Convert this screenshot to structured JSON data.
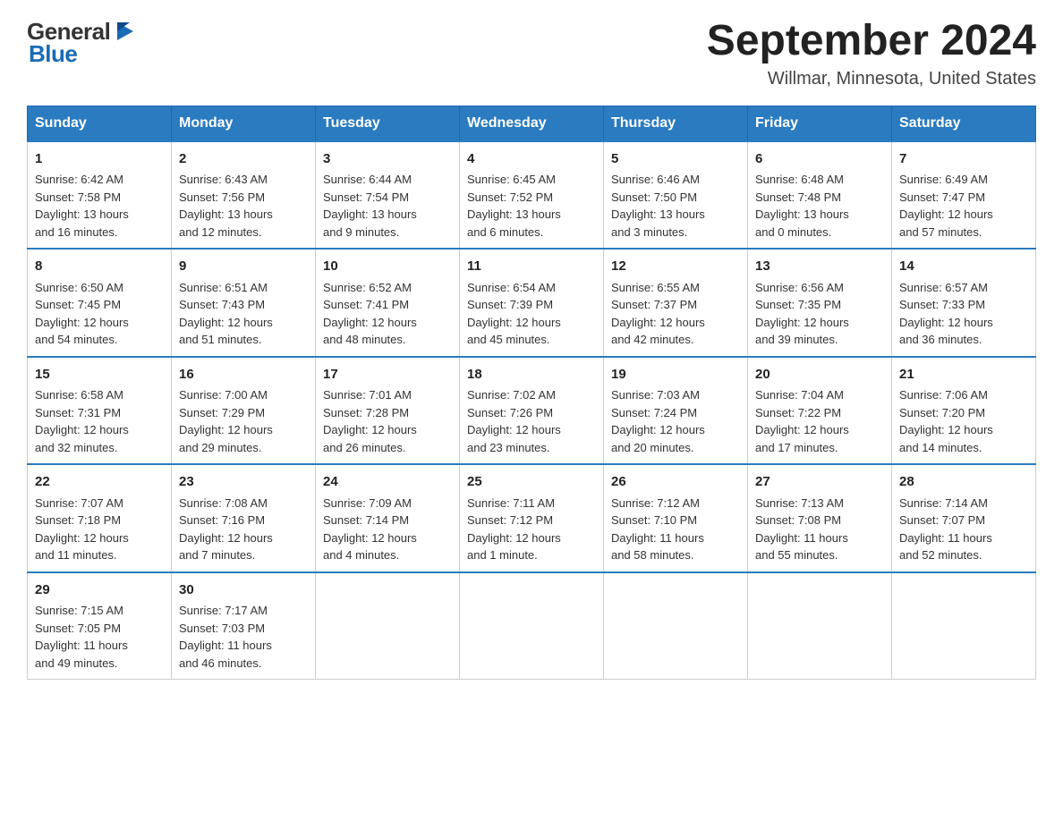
{
  "logo": {
    "general": "General",
    "blue": "Blue"
  },
  "title": {
    "month_year": "September 2024",
    "location": "Willmar, Minnesota, United States"
  },
  "headers": [
    "Sunday",
    "Monday",
    "Tuesday",
    "Wednesday",
    "Thursday",
    "Friday",
    "Saturday"
  ],
  "weeks": [
    [
      {
        "day": "1",
        "info": "Sunrise: 6:42 AM\nSunset: 7:58 PM\nDaylight: 13 hours\nand 16 minutes."
      },
      {
        "day": "2",
        "info": "Sunrise: 6:43 AM\nSunset: 7:56 PM\nDaylight: 13 hours\nand 12 minutes."
      },
      {
        "day": "3",
        "info": "Sunrise: 6:44 AM\nSunset: 7:54 PM\nDaylight: 13 hours\nand 9 minutes."
      },
      {
        "day": "4",
        "info": "Sunrise: 6:45 AM\nSunset: 7:52 PM\nDaylight: 13 hours\nand 6 minutes."
      },
      {
        "day": "5",
        "info": "Sunrise: 6:46 AM\nSunset: 7:50 PM\nDaylight: 13 hours\nand 3 minutes."
      },
      {
        "day": "6",
        "info": "Sunrise: 6:48 AM\nSunset: 7:48 PM\nDaylight: 13 hours\nand 0 minutes."
      },
      {
        "day": "7",
        "info": "Sunrise: 6:49 AM\nSunset: 7:47 PM\nDaylight: 12 hours\nand 57 minutes."
      }
    ],
    [
      {
        "day": "8",
        "info": "Sunrise: 6:50 AM\nSunset: 7:45 PM\nDaylight: 12 hours\nand 54 minutes."
      },
      {
        "day": "9",
        "info": "Sunrise: 6:51 AM\nSunset: 7:43 PM\nDaylight: 12 hours\nand 51 minutes."
      },
      {
        "day": "10",
        "info": "Sunrise: 6:52 AM\nSunset: 7:41 PM\nDaylight: 12 hours\nand 48 minutes."
      },
      {
        "day": "11",
        "info": "Sunrise: 6:54 AM\nSunset: 7:39 PM\nDaylight: 12 hours\nand 45 minutes."
      },
      {
        "day": "12",
        "info": "Sunrise: 6:55 AM\nSunset: 7:37 PM\nDaylight: 12 hours\nand 42 minutes."
      },
      {
        "day": "13",
        "info": "Sunrise: 6:56 AM\nSunset: 7:35 PM\nDaylight: 12 hours\nand 39 minutes."
      },
      {
        "day": "14",
        "info": "Sunrise: 6:57 AM\nSunset: 7:33 PM\nDaylight: 12 hours\nand 36 minutes."
      }
    ],
    [
      {
        "day": "15",
        "info": "Sunrise: 6:58 AM\nSunset: 7:31 PM\nDaylight: 12 hours\nand 32 minutes."
      },
      {
        "day": "16",
        "info": "Sunrise: 7:00 AM\nSunset: 7:29 PM\nDaylight: 12 hours\nand 29 minutes."
      },
      {
        "day": "17",
        "info": "Sunrise: 7:01 AM\nSunset: 7:28 PM\nDaylight: 12 hours\nand 26 minutes."
      },
      {
        "day": "18",
        "info": "Sunrise: 7:02 AM\nSunset: 7:26 PM\nDaylight: 12 hours\nand 23 minutes."
      },
      {
        "day": "19",
        "info": "Sunrise: 7:03 AM\nSunset: 7:24 PM\nDaylight: 12 hours\nand 20 minutes."
      },
      {
        "day": "20",
        "info": "Sunrise: 7:04 AM\nSunset: 7:22 PM\nDaylight: 12 hours\nand 17 minutes."
      },
      {
        "day": "21",
        "info": "Sunrise: 7:06 AM\nSunset: 7:20 PM\nDaylight: 12 hours\nand 14 minutes."
      }
    ],
    [
      {
        "day": "22",
        "info": "Sunrise: 7:07 AM\nSunset: 7:18 PM\nDaylight: 12 hours\nand 11 minutes."
      },
      {
        "day": "23",
        "info": "Sunrise: 7:08 AM\nSunset: 7:16 PM\nDaylight: 12 hours\nand 7 minutes."
      },
      {
        "day": "24",
        "info": "Sunrise: 7:09 AM\nSunset: 7:14 PM\nDaylight: 12 hours\nand 4 minutes."
      },
      {
        "day": "25",
        "info": "Sunrise: 7:11 AM\nSunset: 7:12 PM\nDaylight: 12 hours\nand 1 minute."
      },
      {
        "day": "26",
        "info": "Sunrise: 7:12 AM\nSunset: 7:10 PM\nDaylight: 11 hours\nand 58 minutes."
      },
      {
        "day": "27",
        "info": "Sunrise: 7:13 AM\nSunset: 7:08 PM\nDaylight: 11 hours\nand 55 minutes."
      },
      {
        "day": "28",
        "info": "Sunrise: 7:14 AM\nSunset: 7:07 PM\nDaylight: 11 hours\nand 52 minutes."
      }
    ],
    [
      {
        "day": "29",
        "info": "Sunrise: 7:15 AM\nSunset: 7:05 PM\nDaylight: 11 hours\nand 49 minutes."
      },
      {
        "day": "30",
        "info": "Sunrise: 7:17 AM\nSunset: 7:03 PM\nDaylight: 11 hours\nand 46 minutes."
      },
      {
        "day": "",
        "info": ""
      },
      {
        "day": "",
        "info": ""
      },
      {
        "day": "",
        "info": ""
      },
      {
        "day": "",
        "info": ""
      },
      {
        "day": "",
        "info": ""
      }
    ]
  ]
}
